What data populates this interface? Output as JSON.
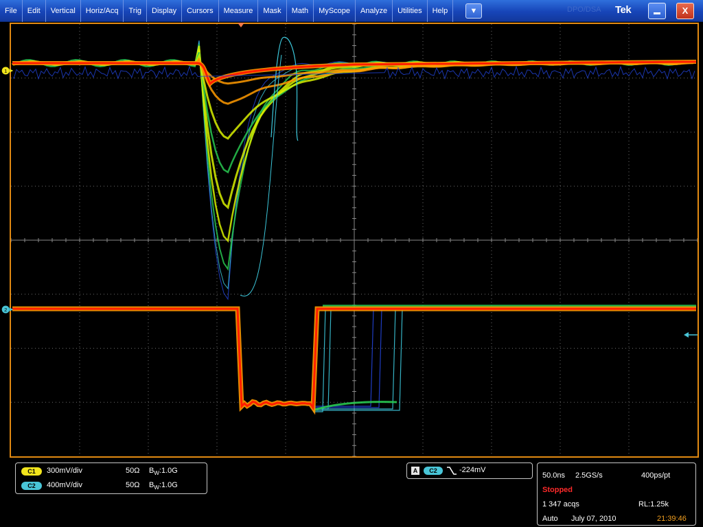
{
  "menubar": {
    "items": [
      "File",
      "Edit",
      "Vertical",
      "Horiz/Acq",
      "Trig",
      "Display",
      "Cursors",
      "Measure",
      "Mask",
      "Math",
      "MyScope",
      "Analyze",
      "Utilities",
      "Help"
    ],
    "dropdown_glyph": "▼",
    "brand": "Tek",
    "brand_faint": "DPO/DSA",
    "close_glyph": "X"
  },
  "display": {
    "channel1_marker": "1",
    "channel2_marker": "2",
    "colors": {
      "grid": "#8a8a8a",
      "frame": "#e28a12",
      "ch1_marker": "#f2e51c",
      "ch2_marker": "#49c6d8",
      "hot": "#ff1e00",
      "warm": "#ff9a00",
      "mid": "#d8f000",
      "cool": "#28c850",
      "cold": "#2244d8",
      "cyan": "#3cc8dc"
    }
  },
  "channels": [
    {
      "badge": "C1",
      "scale": "300mV/div",
      "impedance": "50Ω",
      "bw_prefix": "B",
      "bw_sub": "W",
      "bw_value": ":1.0G",
      "color": "#f2e51c"
    },
    {
      "badge": "C2",
      "scale": "400mV/div",
      "impedance": "50Ω",
      "bw_prefix": "B",
      "bw_sub": "W",
      "bw_value": ":1.0G",
      "color": "#49c6d8"
    }
  ],
  "trigger": {
    "mode_letter": "A",
    "source": "C2",
    "slope_icon": "falling-edge-icon",
    "level": "-224mV"
  },
  "acquisition": {
    "timebase": "50.0ns",
    "sample_rate": "2.5GS/s",
    "resolution": "400ps/pt",
    "state": "Stopped",
    "acqs": "1 347 acqs",
    "record_length": "RL:1.25k",
    "mode": "Auto",
    "date": "July 07, 2010",
    "time": "21:39:46",
    "state_color": "#ff2a2a",
    "time_color": "#f3a020"
  }
}
